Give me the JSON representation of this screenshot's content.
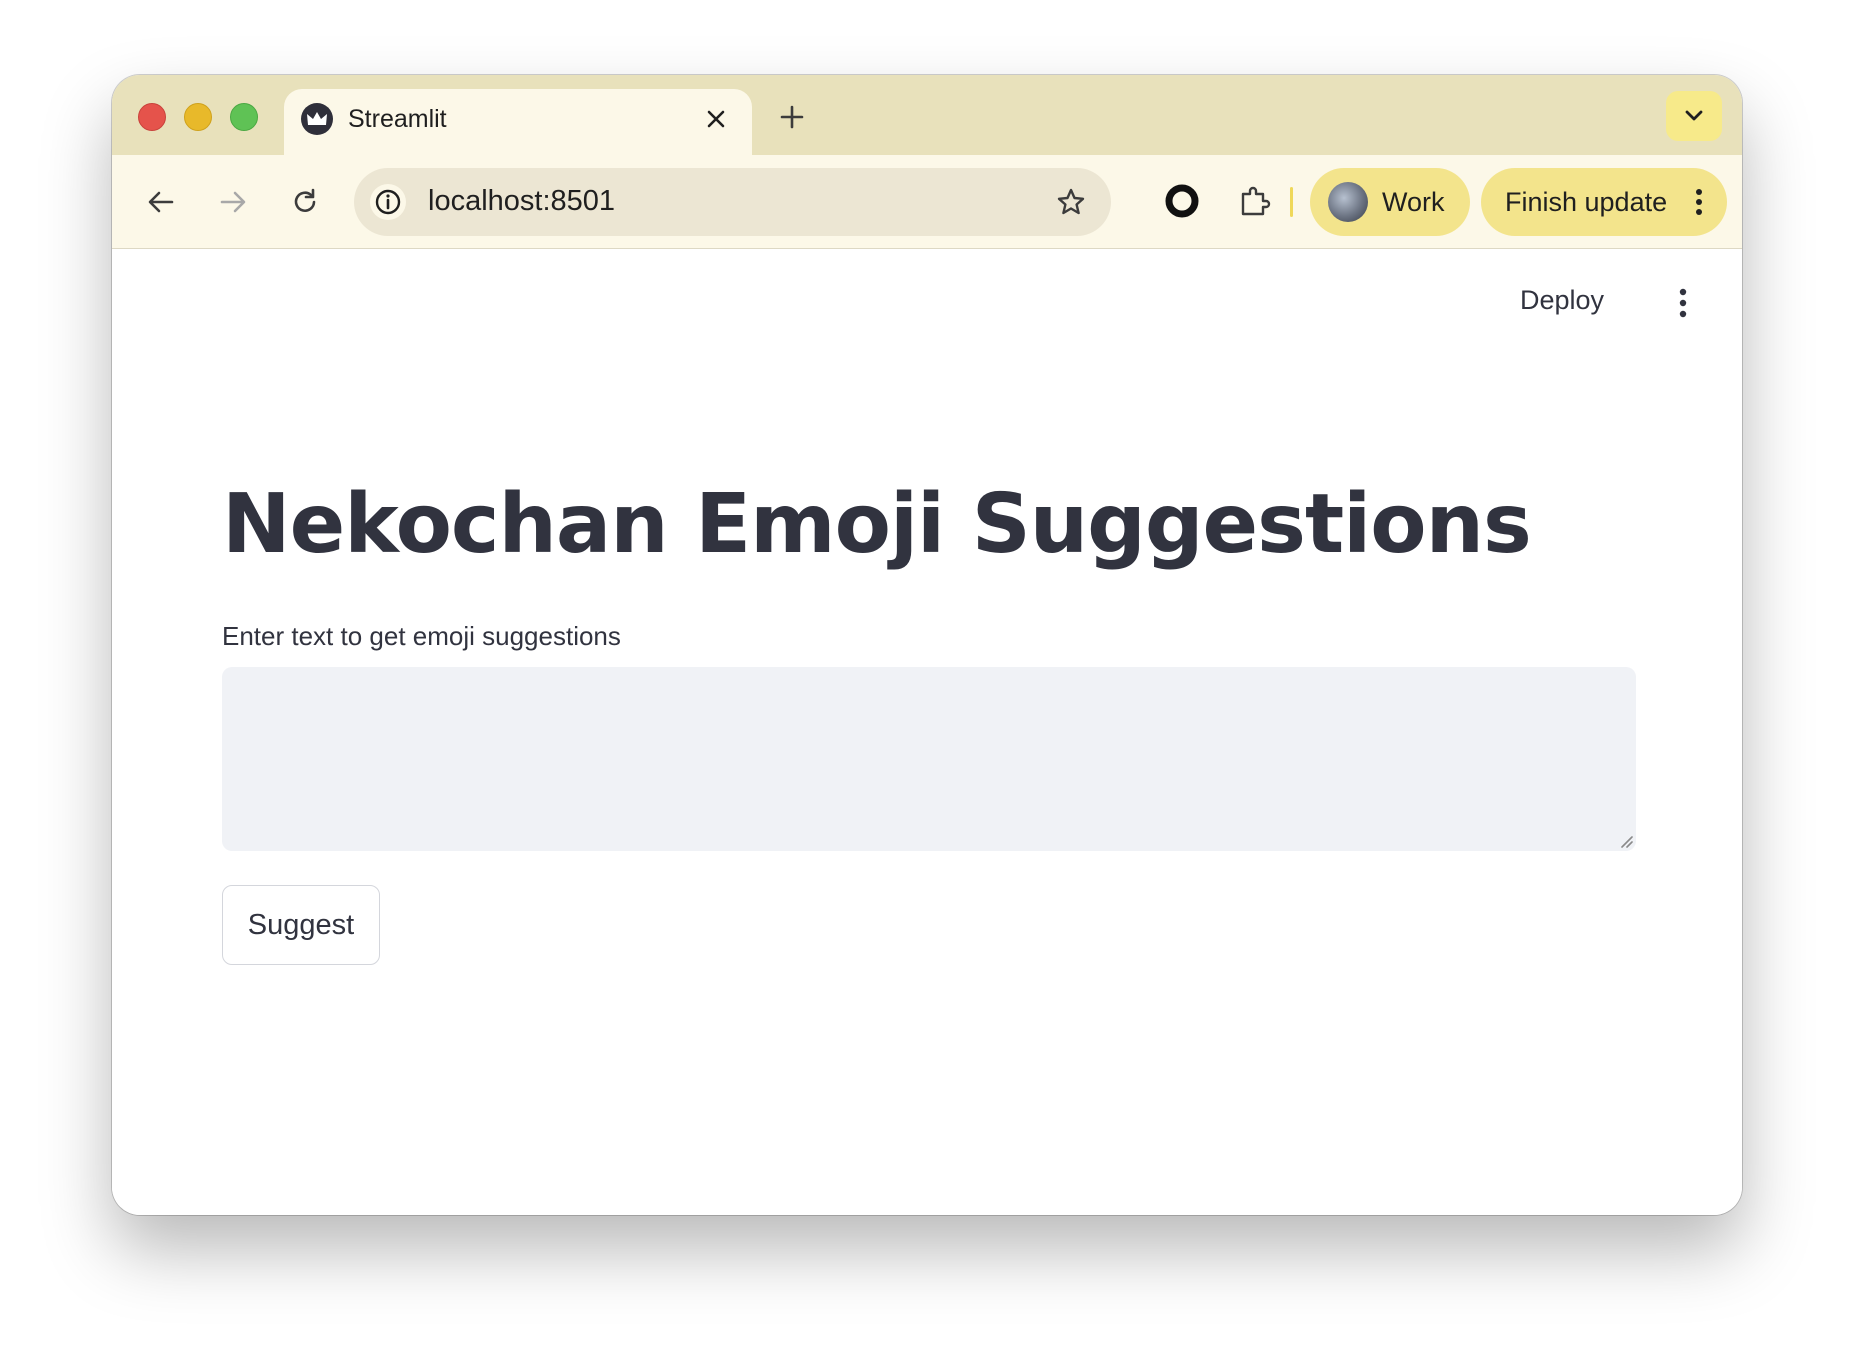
{
  "browser": {
    "tab": {
      "title": "Streamlit",
      "favicon": "streamlit-crown-icon"
    },
    "new_tab_symbol": "+",
    "address_bar": {
      "url": "localhost:8501"
    },
    "profile": {
      "label": "Work"
    },
    "update_button": {
      "label": "Finish update"
    },
    "colors": {
      "tabbar": "#e8e1bb",
      "toolbar": "#fcf8e8",
      "chip": "#f3e48c"
    }
  },
  "app": {
    "header": {
      "deploy_label": "Deploy",
      "menu_icon": "kebab-vertical-icon"
    },
    "title": "Nekochan Emoji Suggestions",
    "input": {
      "label": "Enter text to get emoji suggestions",
      "value": "",
      "placeholder": ""
    },
    "suggest_button": {
      "label": "Suggest"
    },
    "colors": {
      "text": "#31333f",
      "input_bg": "#f0f2f6"
    }
  }
}
